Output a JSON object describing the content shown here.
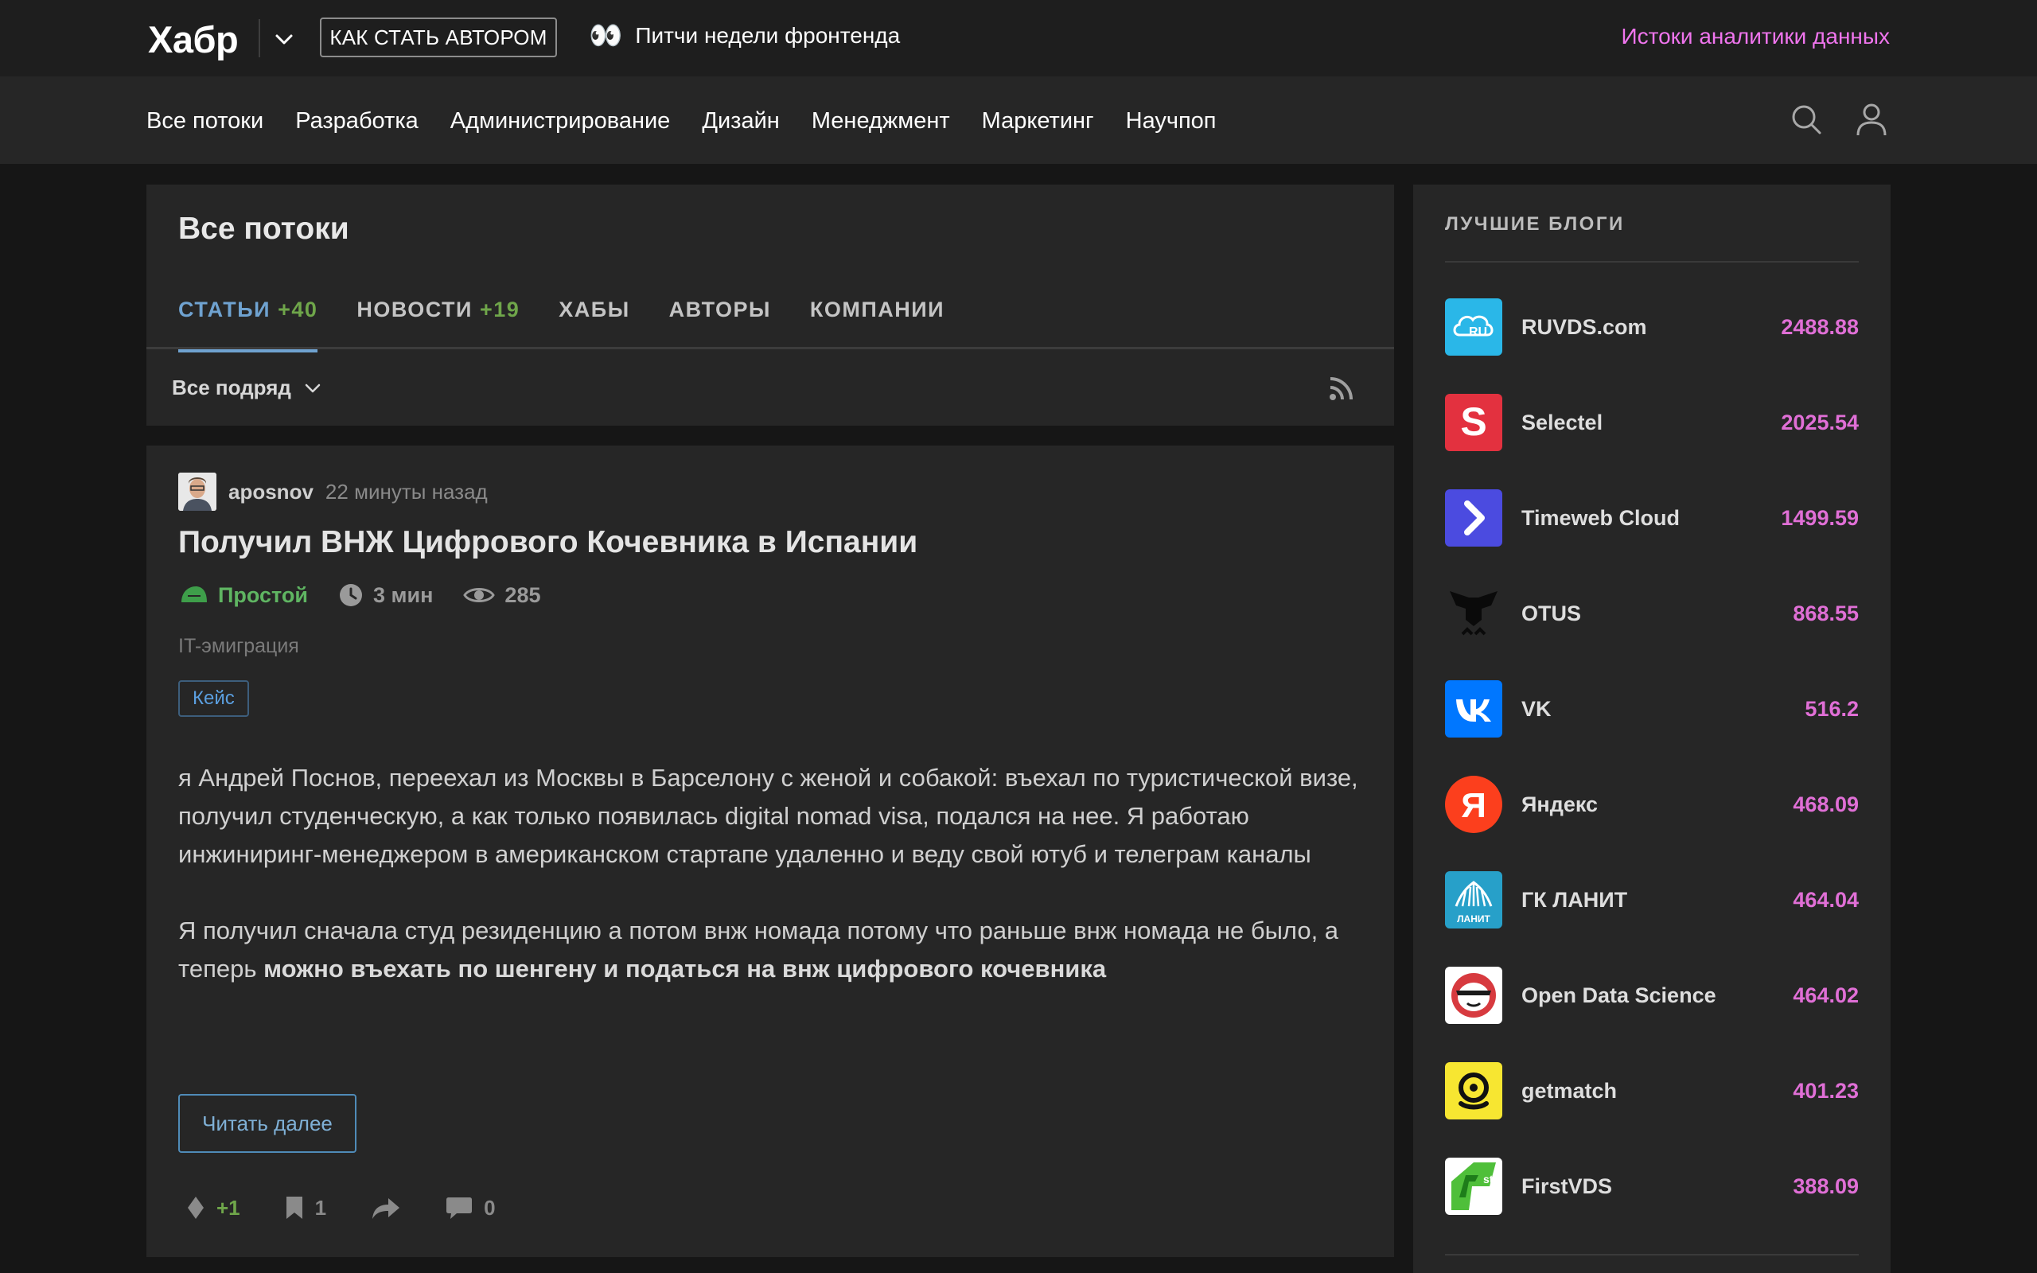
{
  "header": {
    "logo": "Хабр",
    "author_button": "КАК СТАТЬ АВТОРОМ",
    "promo_text": "Питчи недели фронтенда",
    "promo_emoji": "👀",
    "right_link": "Истоки аналитики данных"
  },
  "nav": {
    "items": [
      "Все потоки",
      "Разработка",
      "Администрирование",
      "Дизайн",
      "Менеджмент",
      "Маркетинг",
      "Научпоп"
    ]
  },
  "feed": {
    "title": "Все потоки",
    "tabs": [
      {
        "label": "СТАТЬИ",
        "count": "+40"
      },
      {
        "label": "НОВОСТИ",
        "count": "+19"
      },
      {
        "label": "ХАБЫ",
        "count": ""
      },
      {
        "label": "АВТОРЫ",
        "count": ""
      },
      {
        "label": "КОМПАНИИ",
        "count": ""
      }
    ],
    "filter": "Все подряд"
  },
  "article": {
    "author": "aposnov",
    "time": "22 минуты назад",
    "title": "Получил ВНЖ Цифрового Кочевника в Испании",
    "difficulty": "Простой",
    "reading_time": "3 мин",
    "views": "285",
    "hub": "IT-эмиграция",
    "tag": "Кейс",
    "paragraph1": "я Андрей Поснов, переехал из Москвы в Барселону с женой и собакой: въехал по туристической визе, получил студенческую, а как только появилась digital nomad visa, подался на нее. Я работаю инжиниринг-менеджером в американском стартапе удаленно и веду свой ютуб и телеграм каналы",
    "paragraph2_plain": "Я получил сначала студ резиденцию а потом внж номада потому что раньше внж номада не было, а теперь ",
    "paragraph2_bold": "можно въехать по шенгену и податься на внж цифрового кочевника",
    "read_more": "Читать далее",
    "votes": "+1",
    "bookmarks": "1",
    "comments": "0"
  },
  "sidebar": {
    "title": "ЛУЧШИЕ БЛОГИ",
    "blogs": [
      {
        "name": "RUVDS.com",
        "score": "2488.88",
        "color": "#2ab7e8"
      },
      {
        "name": "Selectel",
        "score": "2025.54",
        "color": "#e3313f"
      },
      {
        "name": "Timeweb Cloud",
        "score": "1499.59",
        "color": "#4b4be0"
      },
      {
        "name": "OTUS",
        "score": "868.55",
        "color": "#1a1a1a"
      },
      {
        "name": "VK",
        "score": "516.2",
        "color": "#0077ff"
      },
      {
        "name": "Яндекс",
        "score": "468.09",
        "color": "#fc3f1d"
      },
      {
        "name": "ГК ЛАНИТ",
        "score": "464.04",
        "color": "#27a0c9"
      },
      {
        "name": "Open Data Science",
        "score": "464.02",
        "color": "#ffffff"
      },
      {
        "name": "getmatch",
        "score": "401.23",
        "color": "#f7e631"
      },
      {
        "name": "FirstVDS",
        "score": "388.09",
        "color": "#ffffff"
      }
    ]
  }
}
